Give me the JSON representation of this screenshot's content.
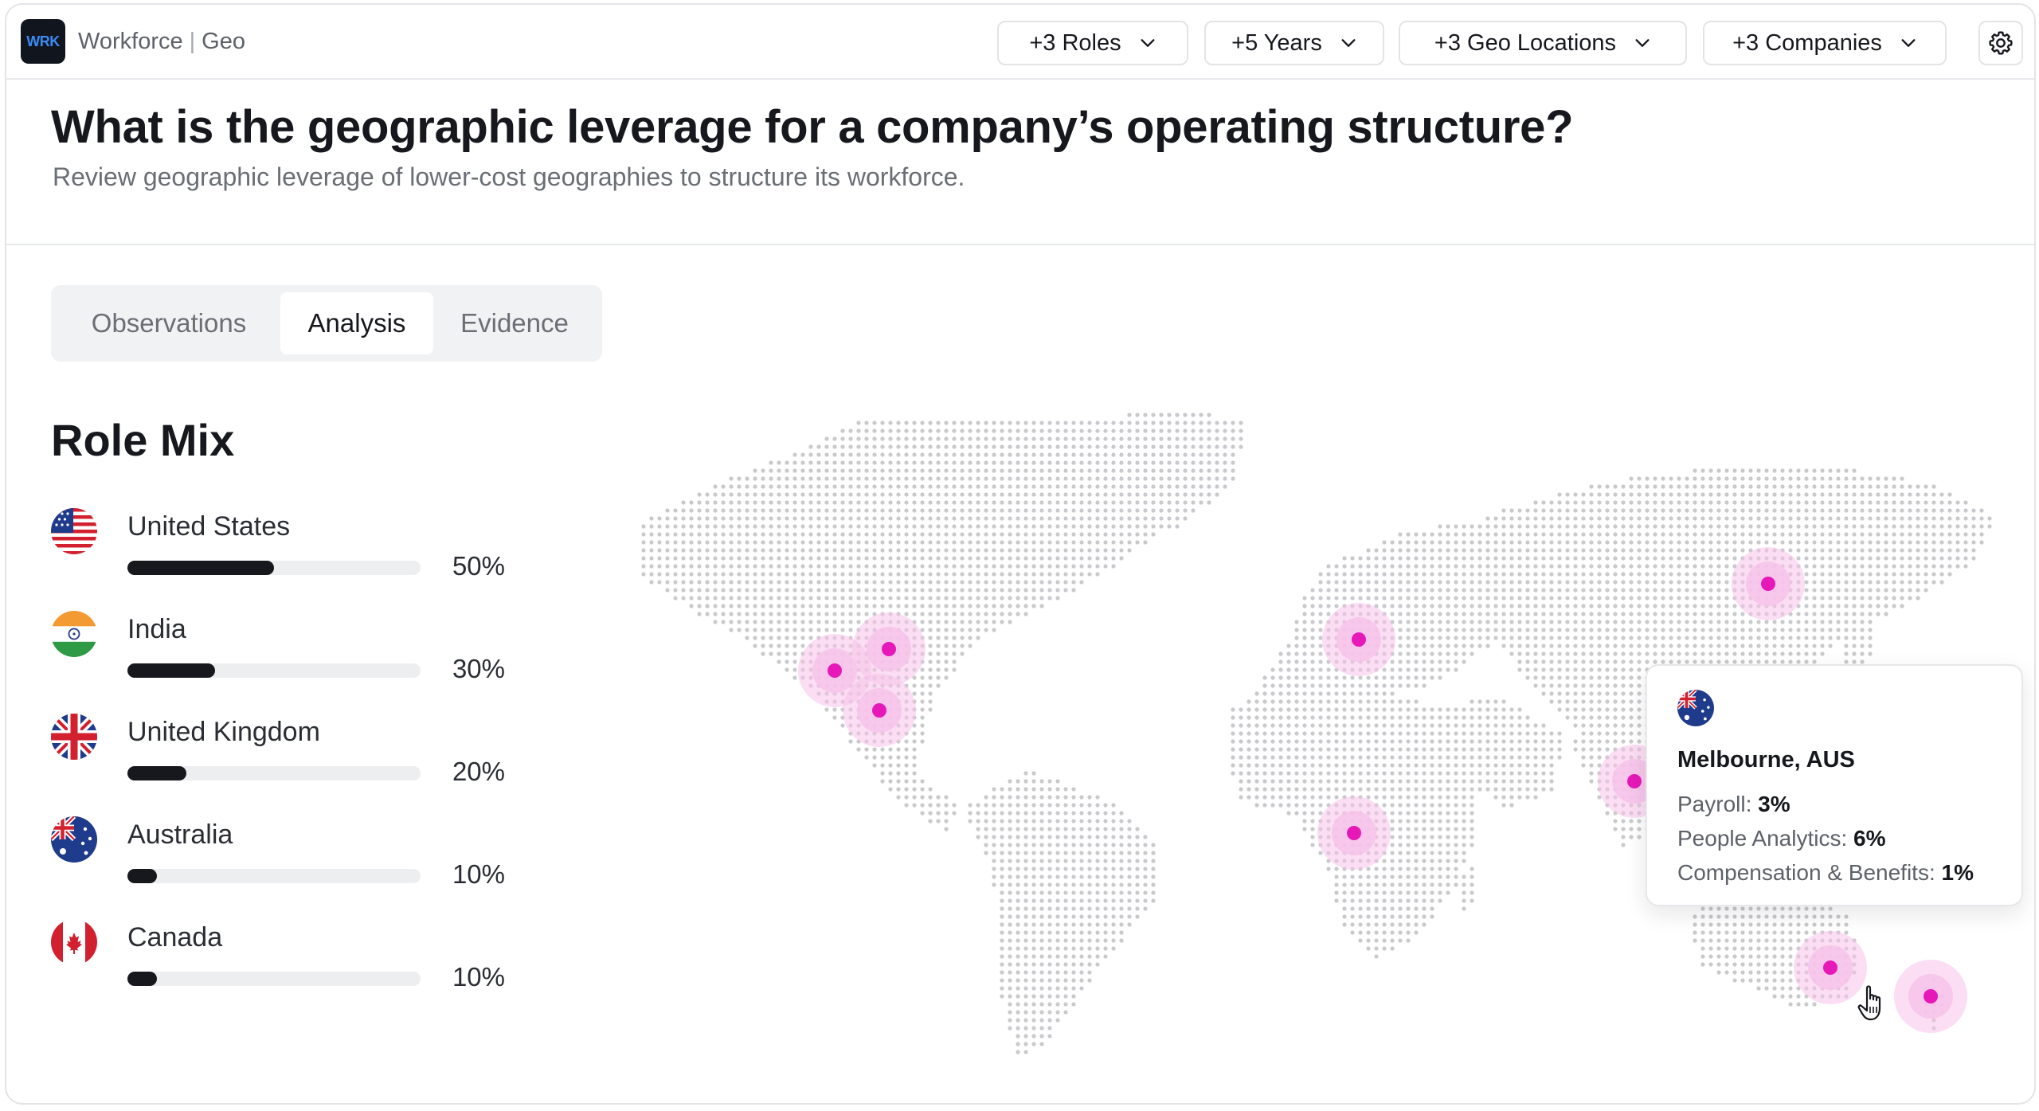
{
  "app": {
    "logo_text": "WRK",
    "name": "Workforce",
    "separator": "|",
    "section": "Geo"
  },
  "filters": [
    {
      "label": "+3 Roles",
      "icon": "chevron-down-icon"
    },
    {
      "label": "+5 Years",
      "icon": "chevron-down-icon"
    },
    {
      "label": "+3 Geo Locations",
      "icon": "chevron-down-icon"
    },
    {
      "label": "+3 Companies",
      "icon": "chevron-down-icon"
    }
  ],
  "settings_icon": "gear-icon",
  "header": {
    "title": "What is the geographic leverage for a company’s operating structure?",
    "subtitle": "Review geographic leverage of lower-cost geographies to structure its workforce."
  },
  "tabs": [
    {
      "label": "Observations",
      "active": false
    },
    {
      "label": "Analysis",
      "active": true
    },
    {
      "label": "Evidence",
      "active": false
    }
  ],
  "role_mix": {
    "title": "Role Mix",
    "items": [
      {
        "country": "United States",
        "percent_label": "50%",
        "value": 0.5,
        "flag": "us-flag-icon"
      },
      {
        "country": "India",
        "percent_label": "30%",
        "value": 0.3,
        "flag": "india-flag-icon"
      },
      {
        "country": "United Kingdom",
        "percent_label": "20%",
        "value": 0.2,
        "flag": "uk-flag-icon"
      },
      {
        "country": "Australia",
        "percent_label": "10%",
        "value": 0.1,
        "flag": "australia-flag-icon"
      },
      {
        "country": "Canada",
        "percent_label": "10%",
        "value": 0.1,
        "flag": "canada-flag-icon"
      }
    ]
  },
  "map": {
    "dot_color": "#c9cacd",
    "marker_color": "#e619b8",
    "halo_color": "#f7c3ea"
  },
  "tooltip": {
    "flag": "australia-flag-icon",
    "city": "Melbourne, AUS",
    "rows": [
      {
        "label": "Payroll:",
        "value": "3%"
      },
      {
        "label": "People Analytics:",
        "value": "6%"
      },
      {
        "label": "Compensation & Benefits:",
        "value": "1%"
      }
    ]
  }
}
